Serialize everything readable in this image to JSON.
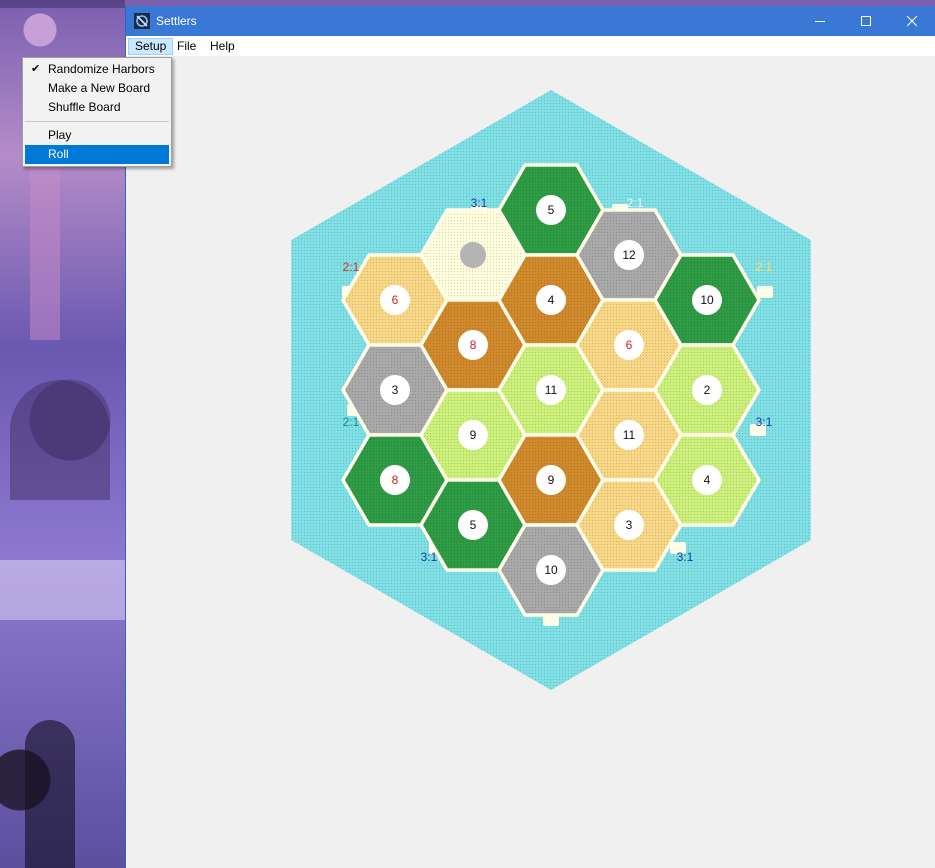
{
  "window": {
    "title": "Settlers",
    "app_icon": "settlers-app-icon"
  },
  "menubar": [
    {
      "label": "Setup",
      "active": true
    },
    {
      "label": "File",
      "active": false
    },
    {
      "label": "Help",
      "active": false
    }
  ],
  "setup_menu": [
    {
      "label": "Randomize Harbors",
      "checked": true
    },
    {
      "label": "Make a New Board",
      "checked": false
    },
    {
      "label": "Shuffle Board",
      "checked": false
    },
    {
      "separator": true
    },
    {
      "label": "Play",
      "checked": false
    },
    {
      "label": "Roll",
      "checked": false,
      "highlighted": true
    }
  ],
  "resource_colors": {
    "forest": "#2e9b45",
    "pasture": "#ccf07a",
    "fields": "#f8d886",
    "hills": "#d08a2c",
    "mountains": "#a9a9a9",
    "desert": "#fffedd",
    "sea": "#7fe0e6"
  },
  "board": {
    "tiles": [
      {
        "col": 0,
        "row": 0,
        "resource": "fields",
        "number": "6",
        "red": true
      },
      {
        "col": 0,
        "row": 1,
        "resource": "mountains",
        "number": "3",
        "red": false
      },
      {
        "col": 0,
        "row": 2,
        "resource": "forest",
        "number": "8",
        "red": true
      },
      {
        "col": 1,
        "row": 0,
        "resource": "desert",
        "number": "",
        "robber": true
      },
      {
        "col": 1,
        "row": 1,
        "resource": "hills",
        "number": "8",
        "red": true
      },
      {
        "col": 1,
        "row": 2,
        "resource": "pasture",
        "number": "9",
        "red": false
      },
      {
        "col": 1,
        "row": 3,
        "resource": "forest",
        "number": "5",
        "red": false
      },
      {
        "col": 2,
        "row": 0,
        "resource": "forest",
        "number": "5",
        "red": false
      },
      {
        "col": 2,
        "row": 1,
        "resource": "hills",
        "number": "4",
        "red": false
      },
      {
        "col": 2,
        "row": 2,
        "resource": "pasture",
        "number": "11",
        "red": false
      },
      {
        "col": 2,
        "row": 3,
        "resource": "hills",
        "number": "9",
        "red": false
      },
      {
        "col": 2,
        "row": 4,
        "resource": "mountains",
        "number": "10",
        "red": false
      },
      {
        "col": 3,
        "row": 0,
        "resource": "mountains",
        "number": "12",
        "red": false
      },
      {
        "col": 3,
        "row": 1,
        "resource": "fields",
        "number": "6",
        "red": true
      },
      {
        "col": 3,
        "row": 2,
        "resource": "fields",
        "number": "11",
        "red": false
      },
      {
        "col": 3,
        "row": 3,
        "resource": "fields",
        "number": "3",
        "red": false
      },
      {
        "col": 4,
        "row": 0,
        "resource": "forest",
        "number": "10",
        "red": false
      },
      {
        "col": 4,
        "row": 1,
        "resource": "pasture",
        "number": "2",
        "red": false
      },
      {
        "col": 4,
        "row": 2,
        "resource": "pasture",
        "number": "4",
        "red": false
      }
    ],
    "harbors": [
      {
        "label": "3:1",
        "color": "#1a3fa8"
      },
      {
        "label": "2:1",
        "color": "#eef2f2"
      },
      {
        "label": "2:1",
        "color": "#d83020"
      },
      {
        "label": "2:1",
        "color": "#ffe070"
      },
      {
        "label": "2:1",
        "color": "#1a8a8a"
      },
      {
        "label": "3:1",
        "color": "#1a3fa8"
      },
      {
        "label": "3:1",
        "color": "#1a3fa8"
      },
      {
        "label": "3:1",
        "color": "#1a3fa8"
      }
    ]
  }
}
